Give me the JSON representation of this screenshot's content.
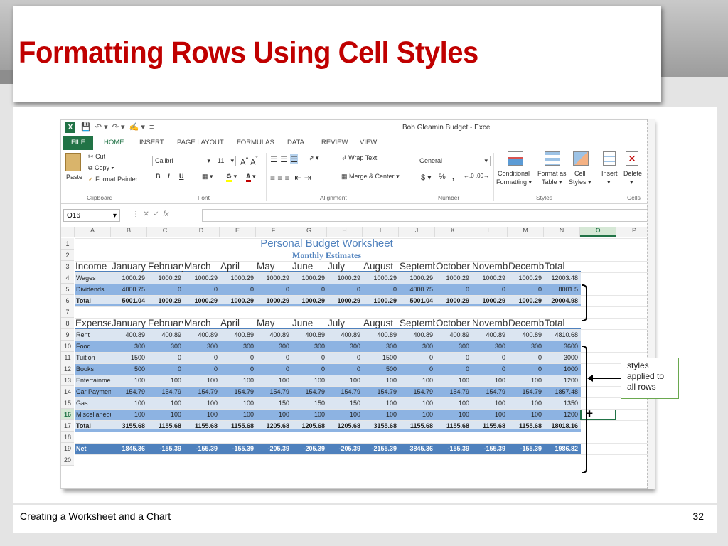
{
  "slide": {
    "title": "Formatting Rows Using Cell Styles",
    "footer_left": "Creating a Worksheet and a Chart",
    "page_number": "32"
  },
  "excel": {
    "window_title": "Bob Gleamin Budget - Excel",
    "menu": [
      "FILE",
      "HOME",
      "INSERT",
      "PAGE LAYOUT",
      "FORMULAS",
      "DATA",
      "REVIEW",
      "VIEW"
    ],
    "clipboard": {
      "paste": "Paste",
      "cut": "Cut",
      "copy": "Copy",
      "painter": "Format Painter",
      "group": "Clipboard"
    },
    "font": {
      "name": "Calibri",
      "size": "11",
      "group": "Font",
      "bold": "B",
      "italic": "I",
      "underline": "U"
    },
    "alignment": {
      "wrap": "Wrap Text",
      "merge": "Merge & Center",
      "group": "Alignment"
    },
    "number": {
      "format": "General",
      "currency": "$",
      "percent": "%",
      "comma": ",",
      "group": "Number"
    },
    "styles": {
      "cond1": "Conditional",
      "cond2": "Formatting",
      "fmt1": "Format as",
      "fmt2": "Table",
      "cell1": "Cell",
      "cell2": "Styles",
      "group": "Styles"
    },
    "cells": {
      "insert": "Insert",
      "delete": "Delete",
      "group": "Cells"
    },
    "name_box": "O16",
    "fx": "fx",
    "columns": [
      "A",
      "B",
      "C",
      "D",
      "E",
      "F",
      "G",
      "H",
      "I",
      "J",
      "K",
      "L",
      "M",
      "N",
      "O",
      "P"
    ],
    "title": "Personal Budget Worksheet",
    "subtitle": "Monthly Estimates",
    "income_header": [
      "Income",
      "January",
      "February",
      "March",
      "April",
      "May",
      "June",
      "July",
      "August",
      "September",
      "October",
      "November",
      "December",
      "Total"
    ],
    "expense_header": [
      "Expenses",
      "January",
      "February",
      "March",
      "April",
      "May",
      "June",
      "July",
      "August",
      "September",
      "October",
      "November",
      "December",
      "Total"
    ],
    "rows": [
      {
        "n": "4",
        "cells": [
          "Wages",
          "1000.29",
          "1000.29",
          "1000.29",
          "1000.29",
          "1000.29",
          "1000.29",
          "1000.29",
          "1000.29",
          "1000.29",
          "1000.29",
          "1000.29",
          "1000.29",
          "12003.48"
        ]
      },
      {
        "n": "5",
        "cells": [
          "Dividends",
          "4000.75",
          "0",
          "0",
          "0",
          "0",
          "0",
          "0",
          "0",
          "4000.75",
          "0",
          "0",
          "0",
          "8001.5"
        ]
      },
      {
        "n": "6",
        "cells": [
          "Total",
          "5001.04",
          "1000.29",
          "1000.29",
          "1000.29",
          "1000.29",
          "1000.29",
          "1000.29",
          "1000.29",
          "5001.04",
          "1000.29",
          "1000.29",
          "1000.29",
          "20004.98"
        ]
      },
      {
        "n": "9",
        "cells": [
          "Rent",
          "400.89",
          "400.89",
          "400.89",
          "400.89",
          "400.89",
          "400.89",
          "400.89",
          "400.89",
          "400.89",
          "400.89",
          "400.89",
          "400.89",
          "4810.68"
        ]
      },
      {
        "n": "10",
        "cells": [
          "Food",
          "300",
          "300",
          "300",
          "300",
          "300",
          "300",
          "300",
          "300",
          "300",
          "300",
          "300",
          "300",
          "3600"
        ]
      },
      {
        "n": "11",
        "cells": [
          "Tuition",
          "1500",
          "0",
          "0",
          "0",
          "0",
          "0",
          "0",
          "1500",
          "0",
          "0",
          "0",
          "0",
          "3000"
        ]
      },
      {
        "n": "12",
        "cells": [
          "Books",
          "500",
          "0",
          "0",
          "0",
          "0",
          "0",
          "0",
          "500",
          "0",
          "0",
          "0",
          "0",
          "1000"
        ]
      },
      {
        "n": "13",
        "cells": [
          "Entertainment",
          "100",
          "100",
          "100",
          "100",
          "100",
          "100",
          "100",
          "100",
          "100",
          "100",
          "100",
          "100",
          "1200"
        ]
      },
      {
        "n": "14",
        "cells": [
          "Car Payment",
          "154.79",
          "154.79",
          "154.79",
          "154.79",
          "154.79",
          "154.79",
          "154.79",
          "154.79",
          "154.79",
          "154.79",
          "154.79",
          "154.79",
          "1857.48"
        ]
      },
      {
        "n": "15",
        "cells": [
          "Gas",
          "100",
          "100",
          "100",
          "100",
          "150",
          "150",
          "150",
          "100",
          "100",
          "100",
          "100",
          "100",
          "1350"
        ]
      },
      {
        "n": "16",
        "cells": [
          "Miscellaneous",
          "100",
          "100",
          "100",
          "100",
          "100",
          "100",
          "100",
          "100",
          "100",
          "100",
          "100",
          "100",
          "1200"
        ]
      },
      {
        "n": "17",
        "cells": [
          "Total",
          "3155.68",
          "1155.68",
          "1155.68",
          "1155.68",
          "1205.68",
          "1205.68",
          "1205.68",
          "3155.68",
          "1155.68",
          "1155.68",
          "1155.68",
          "1155.68",
          "18018.16"
        ]
      },
      {
        "n": "19",
        "cells": [
          "Net",
          "1845.36",
          "-155.39",
          "-155.39",
          "-155.39",
          "-205.39",
          "-205.39",
          "-205.39",
          "-2155.39",
          "3845.36",
          "-155.39",
          "-155.39",
          "-155.39",
          "1986.82"
        ]
      }
    ],
    "row_numbers": [
      "1",
      "2",
      "3",
      "4",
      "5",
      "6",
      "7",
      "8",
      "9",
      "10",
      "11",
      "12",
      "13",
      "14",
      "15",
      "16",
      "17",
      "18",
      "19",
      "20"
    ]
  },
  "callout": {
    "text1": "styles",
    "text2": "applied to",
    "text3": "all rows"
  },
  "colors": {
    "title_red": "#c00000",
    "excel_green": "#217346",
    "band_blue": "#8db3e2",
    "band_light": "#dbe5f1",
    "net_blue": "#4f81bd"
  }
}
